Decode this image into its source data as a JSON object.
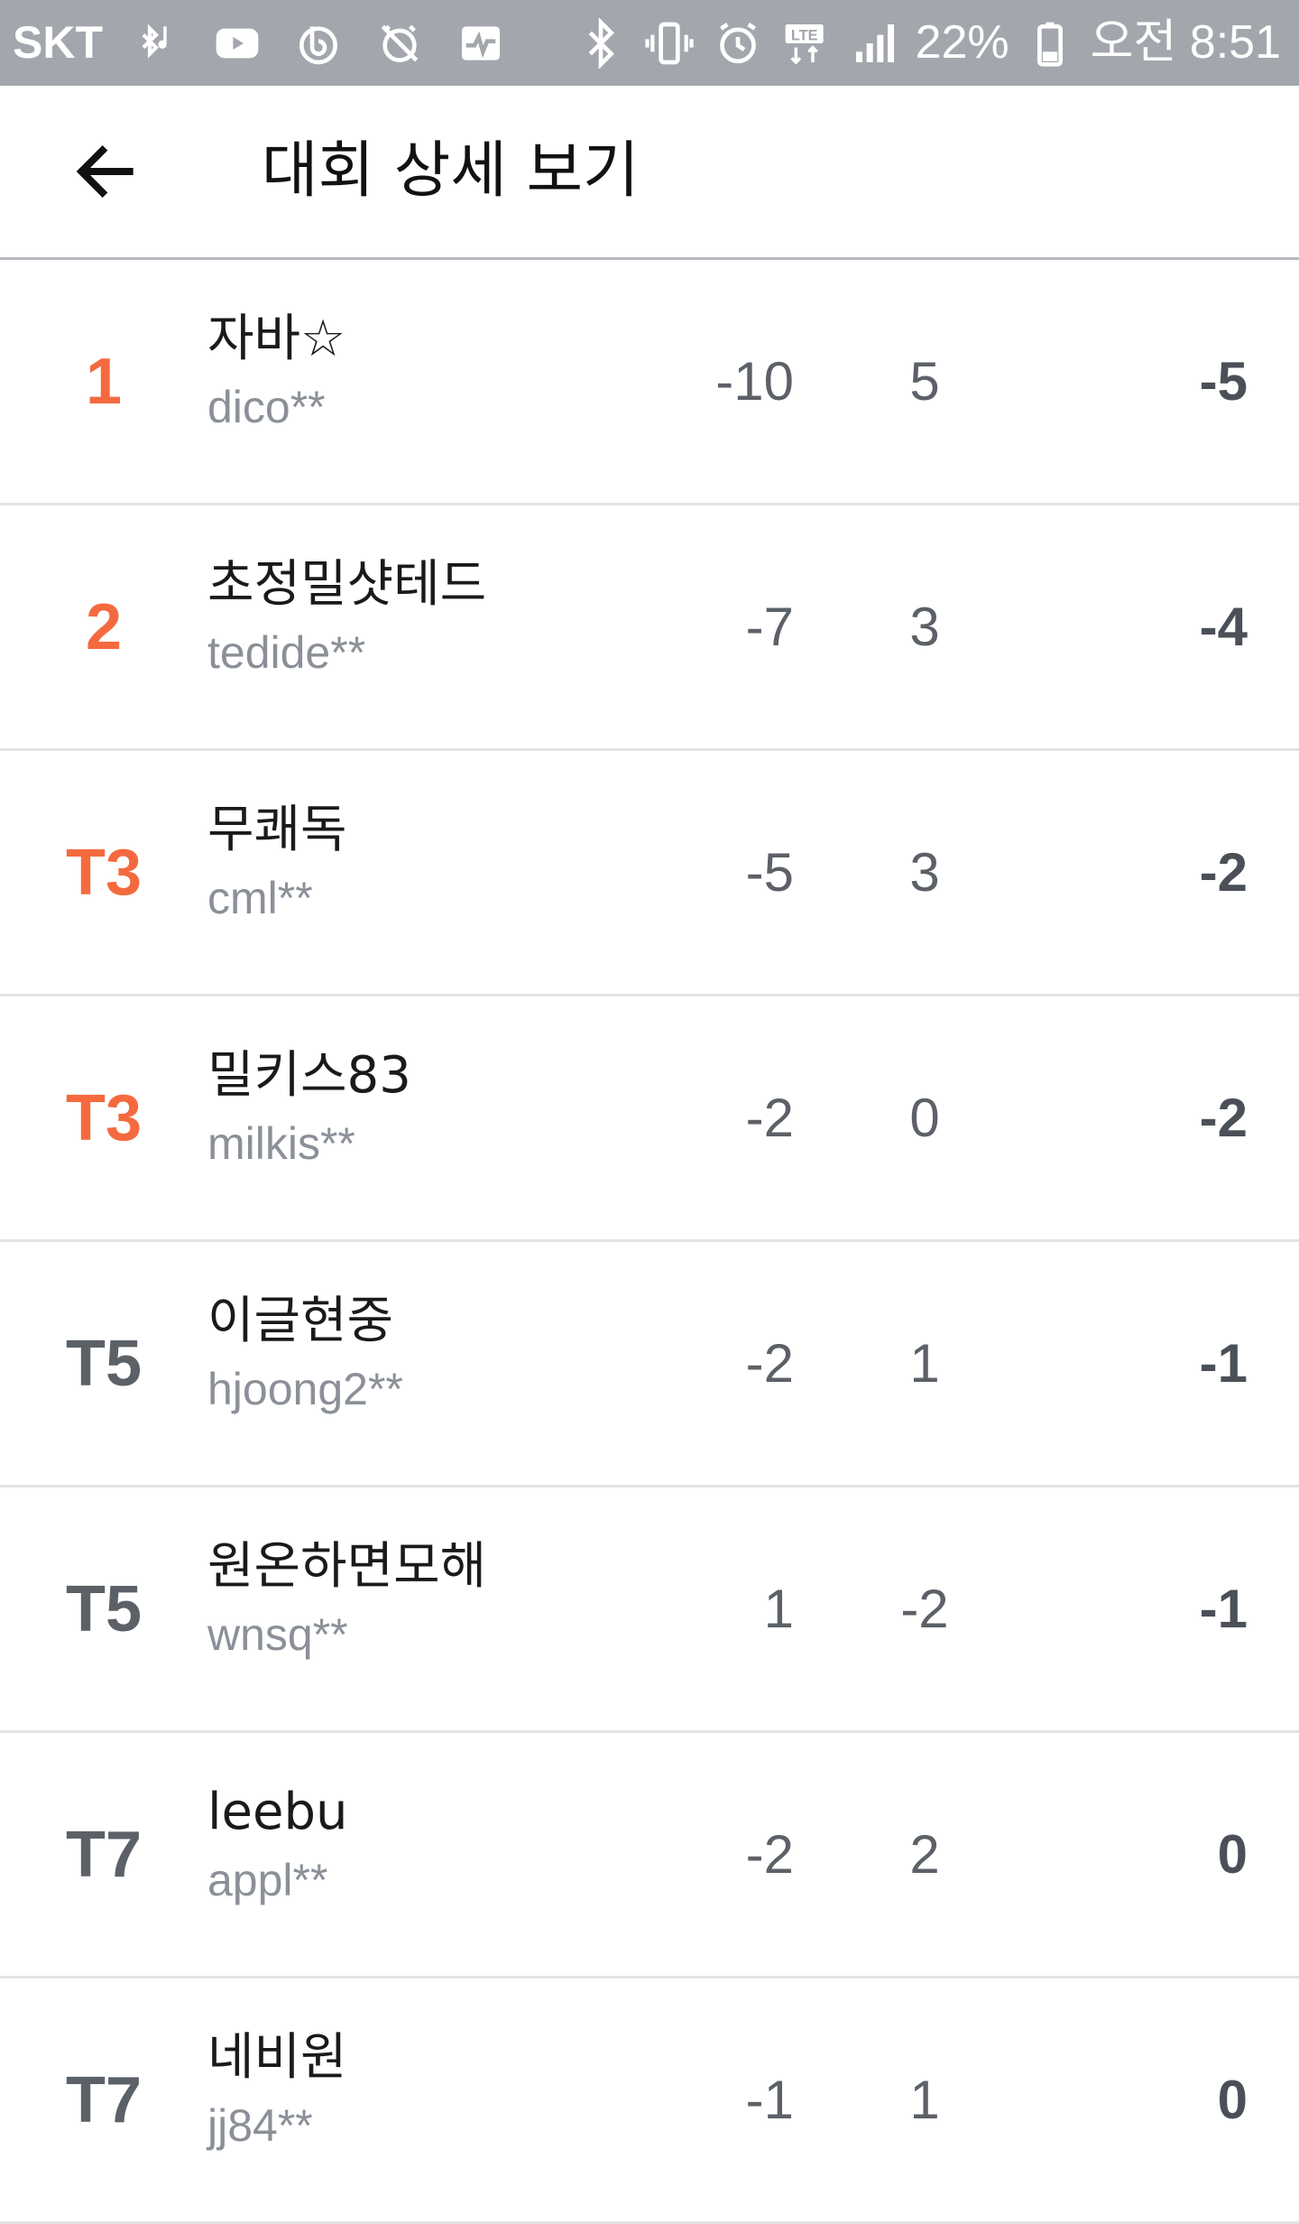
{
  "status_bar": {
    "carrier": "SKT",
    "battery": "22%",
    "time": "오전 8:51",
    "left_icons": [
      "bluetooth-music-icon",
      "youtube-icon",
      "b-app-icon",
      "alarm-off-icon",
      "activity-icon"
    ],
    "right_icons": [
      "bluetooth-icon",
      "vibrate-icon",
      "alarm-icon",
      "lte-icon",
      "signal-icon",
      "battery-icon"
    ]
  },
  "header": {
    "title": "대회 상세 보기",
    "back_icon": "arrow-left-icon"
  },
  "colors": {
    "accent_rank": "#f46a3e",
    "rank_default": "#5c6168",
    "status_bar_bg": "#a3a7ad"
  },
  "rows": [
    {
      "rank": "1",
      "highlight": true,
      "nickname": "자바☆",
      "userid": "dico**",
      "front": "-10",
      "back": "5",
      "total": "-5"
    },
    {
      "rank": "2",
      "highlight": true,
      "nickname": "초정밀샷테드",
      "userid": "tedide**",
      "front": "-7",
      "back": "3",
      "total": "-4"
    },
    {
      "rank": "T3",
      "highlight": true,
      "nickname": "무쾌독",
      "userid": "cml**",
      "front": "-5",
      "back": "3",
      "total": "-2"
    },
    {
      "rank": "T3",
      "highlight": true,
      "nickname": "밀키스83",
      "userid": "milkis**",
      "front": "-2",
      "back": "0",
      "total": "-2"
    },
    {
      "rank": "T5",
      "highlight": false,
      "nickname": "이글현중",
      "userid": "hjoong2**",
      "front": "-2",
      "back": "1",
      "total": "-1"
    },
    {
      "rank": "T5",
      "highlight": false,
      "nickname": "원온하면모해",
      "userid": "wnsq**",
      "front": "1",
      "back": "-2",
      "total": "-1"
    },
    {
      "rank": "T7",
      "highlight": false,
      "nickname": "leebu",
      "userid": "appl**",
      "front": "-2",
      "back": "2",
      "total": "0"
    },
    {
      "rank": "T7",
      "highlight": false,
      "nickname": "네비원",
      "userid": "jj84**",
      "front": "-1",
      "back": "1",
      "total": "0"
    }
  ]
}
